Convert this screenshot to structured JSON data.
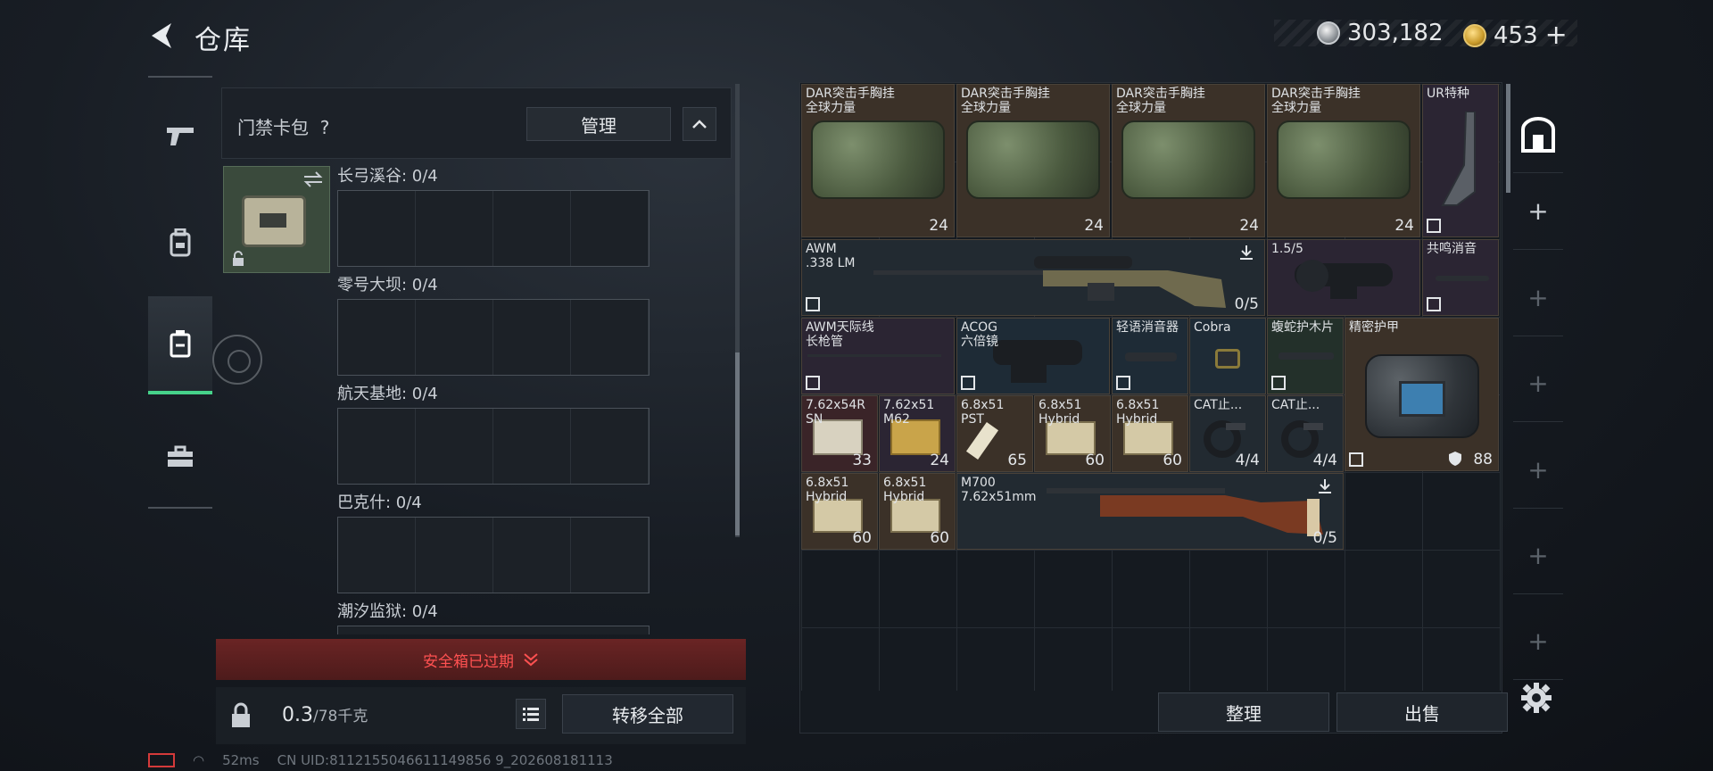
{
  "header": {
    "title": "仓库"
  },
  "currency": {
    "silver": "303,182",
    "gold": "453",
    "gold_add": "+"
  },
  "nav": {
    "items": [
      "weapons",
      "backpack",
      "case",
      "toolbox"
    ]
  },
  "keycard_panel": {
    "title": "门禁卡包",
    "help": "?",
    "manage_label": "管理",
    "zones": [
      {
        "name": "长弓溪谷: 0/4"
      },
      {
        "name": "零号大坝: 0/4"
      },
      {
        "name": "航天基地: 0/4"
      },
      {
        "name": "巴克什: 0/4"
      },
      {
        "name": "潮汐监狱: 0/4"
      }
    ],
    "expired_label": "安全箱已过期",
    "weight_value": "0.3",
    "weight_max": "/78千克",
    "transfer_label": "转移全部"
  },
  "inventory": {
    "items": [
      {
        "name": "DAR突击手胸挂\n全球力量",
        "count": "24",
        "color": "brown"
      },
      {
        "name": "DAR突击手胸挂\n全球力量",
        "count": "24",
        "color": "brown"
      },
      {
        "name": "DAR突击手胸挂\n全球力量",
        "count": "24",
        "color": "brown"
      },
      {
        "name": "DAR突击手胸挂\n全球力量",
        "count": "24",
        "color": "brown"
      },
      {
        "name": "UR特种",
        "count": "",
        "color": "purple"
      },
      {
        "name": "AWM\n.338 LM",
        "count": "0/5",
        "color": "gray"
      },
      {
        "name": "1.5/5",
        "count": "",
        "color": "purple"
      },
      {
        "name": "共鸣消音",
        "count": "",
        "color": "purple"
      },
      {
        "name": "AWM天际线\n长枪管",
        "count": "",
        "color": "purple"
      },
      {
        "name": "ACOG\n六倍镜",
        "count": "",
        "color": "blue"
      },
      {
        "name": "轻语消音器",
        "count": "",
        "color": "blue"
      },
      {
        "name": "Cobra",
        "count": "",
        "color": "blue"
      },
      {
        "name": "蝮蛇护木片",
        "count": "",
        "color": "green"
      },
      {
        "name": "精密护甲",
        "count": "88",
        "color": "brown"
      },
      {
        "name": "7.62x54R\nSN",
        "count": "33",
        "color": "red"
      },
      {
        "name": "7.62x51\nM62",
        "count": "24",
        "color": "purple"
      },
      {
        "name": "6.8x51\nPST",
        "count": "65",
        "color": "brown"
      },
      {
        "name": "6.8x51\nHybrid",
        "count": "60",
        "color": "brown"
      },
      {
        "name": "6.8x51\nHybrid",
        "count": "60",
        "color": "brown"
      },
      {
        "name": "CAT止...",
        "count": "4/4",
        "color": "gray"
      },
      {
        "name": "CAT止...",
        "count": "4/4",
        "color": "gray"
      },
      {
        "name": "6.8x51\nHybrid",
        "count": "60",
        "color": "brown"
      },
      {
        "name": "6.8x51\nHybrid",
        "count": "60",
        "color": "brown"
      },
      {
        "name": "M700\n7.62x51mm",
        "count": "0/5",
        "color": "gray"
      }
    ],
    "sort_label": "整理",
    "sell_label": "出售"
  },
  "status": {
    "ping": "52ms",
    "uid": "CN UID:8112155046611149856 9_202608181113"
  }
}
